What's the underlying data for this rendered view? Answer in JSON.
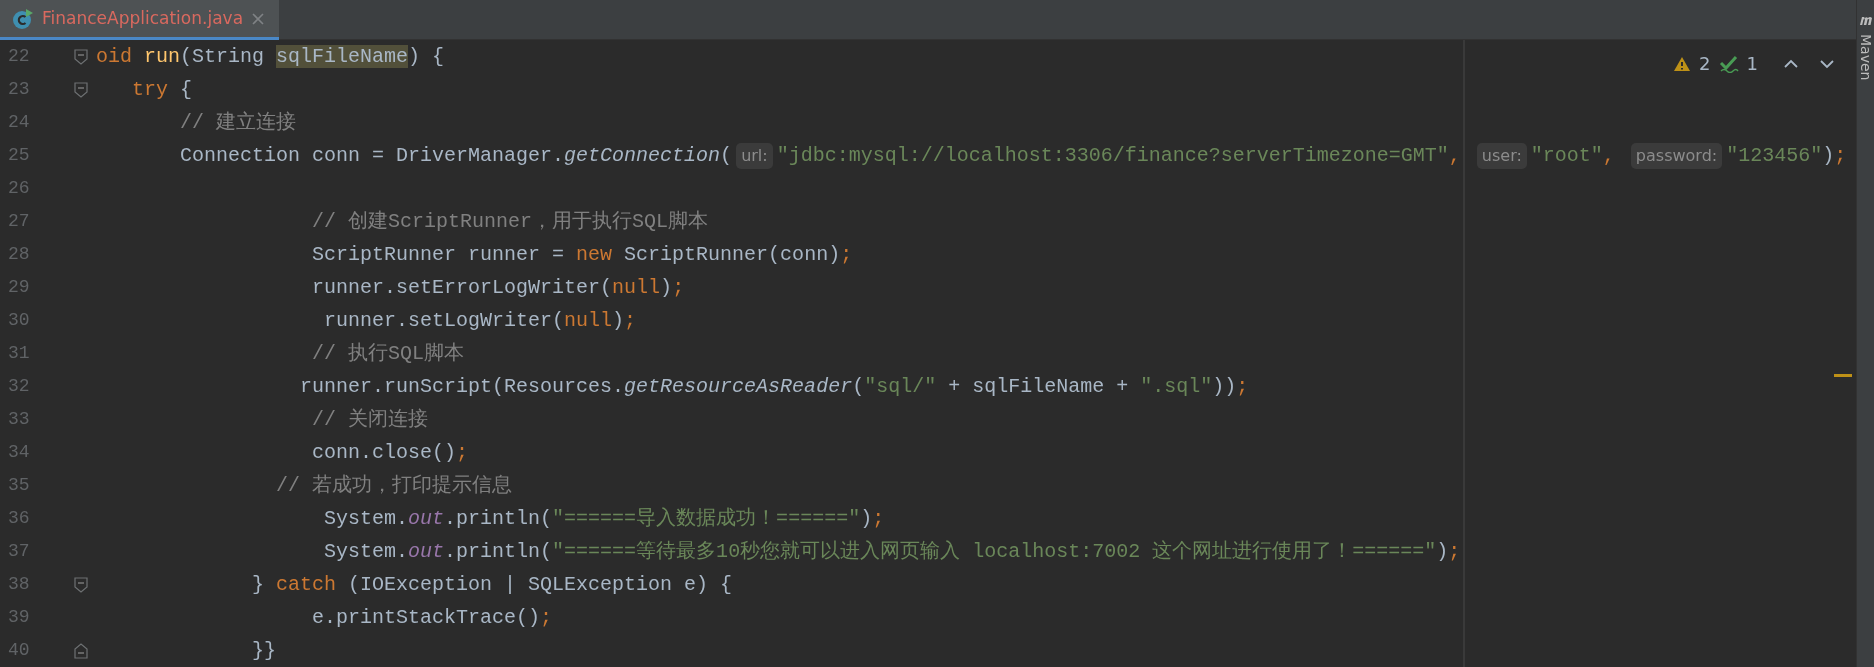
{
  "tabs": [
    {
      "label": "FinanceApplication.java",
      "selected": true
    }
  ],
  "inspections": {
    "warnings": "2",
    "weak_warnings": "1"
  },
  "side_panel": {
    "label": "Maven"
  },
  "lines": [
    {
      "number": "22",
      "fold_start": true,
      "tokens": [
        {
          "text": "oid ",
          "kind": "keyword"
        },
        {
          "text": "run",
          "kind": "function"
        },
        {
          "text": "(String ",
          "kind": "plain"
        },
        {
          "text": "sqlFileName",
          "kind": "match"
        },
        {
          "text": ") {",
          "kind": "plain"
        }
      ]
    },
    {
      "number": "23",
      "fold_start": true,
      "tokens": [
        {
          "text": "   try",
          "kind": "keyword"
        },
        {
          "text": " {",
          "kind": "plain"
        }
      ]
    },
    {
      "number": "24",
      "tokens": [
        {
          "text": "       // 建立连接",
          "kind": "comment"
        }
      ]
    },
    {
      "number": "25",
      "tokens": [
        {
          "text": "       Connection conn = DriverManager.",
          "kind": "plain"
        },
        {
          "text": "getConnection",
          "kind": "static"
        },
        {
          "text": "(",
          "kind": "plain"
        },
        {
          "text": "url:",
          "kind": "hint"
        },
        {
          "text": "\"jdbc:mysql://localhost:3306/finance?serverTimezone=GMT\"",
          "kind": "string"
        },
        {
          "text": ", ",
          "kind": "punct"
        },
        {
          "text": "user:",
          "kind": "hint"
        },
        {
          "text": "\"root\"",
          "kind": "string"
        },
        {
          "text": ", ",
          "kind": "punct"
        },
        {
          "text": "password:",
          "kind": "hint"
        },
        {
          "text": "\"123456\"",
          "kind": "string"
        },
        {
          "text": ")",
          "kind": "plain"
        },
        {
          "text": ";",
          "kind": "punct"
        }
      ]
    },
    {
      "number": "26"
    },
    {
      "number": "27",
      "tokens": [
        {
          "text": "                  // 创建ScriptRunner，用于执行SQL脚本",
          "kind": "comment"
        }
      ]
    },
    {
      "number": "28",
      "tokens": [
        {
          "text": "                  ScriptRunner runner = ",
          "kind": "plain"
        },
        {
          "text": "new",
          "kind": "keyword"
        },
        {
          "text": " ScriptRunner(conn)",
          "kind": "plain"
        },
        {
          "text": ";",
          "kind": "punct"
        }
      ]
    },
    {
      "number": "29",
      "tokens": [
        {
          "text": "                  runner.setErrorLogWriter(",
          "kind": "plain"
        },
        {
          "text": "null",
          "kind": "keyword"
        },
        {
          "text": ")",
          "kind": "plain"
        },
        {
          "text": ";",
          "kind": "punct"
        }
      ]
    },
    {
      "number": "30",
      "tokens": [
        {
          "text": "                   runner.setLogWriter(",
          "kind": "plain"
        },
        {
          "text": "null",
          "kind": "keyword"
        },
        {
          "text": ")",
          "kind": "plain"
        },
        {
          "text": ";",
          "kind": "punct"
        }
      ]
    },
    {
      "number": "31",
      "tokens": [
        {
          "text": "                  // 执行SQL脚本",
          "kind": "comment"
        }
      ]
    },
    {
      "number": "32",
      "tokens": [
        {
          "text": "                 runner.runScript(Resources.",
          "kind": "plain"
        },
        {
          "text": "getResourceAsReader",
          "kind": "static"
        },
        {
          "text": "(",
          "kind": "plain"
        },
        {
          "text": "\"sql/\"",
          "kind": "string"
        },
        {
          "text": " + sqlFileName + ",
          "kind": "plain"
        },
        {
          "text": "\".sql\"",
          "kind": "string"
        },
        {
          "text": "))",
          "kind": "plain"
        },
        {
          "text": ";",
          "kind": "punct"
        }
      ]
    },
    {
      "number": "33",
      "tokens": [
        {
          "text": "                  // 关闭连接",
          "kind": "comment"
        }
      ]
    },
    {
      "number": "34",
      "tokens": [
        {
          "text": "                  conn.close()",
          "kind": "plain"
        },
        {
          "text": ";",
          "kind": "punct"
        }
      ]
    },
    {
      "number": "35",
      "tokens": [
        {
          "text": "               // 若成功，打印提示信息",
          "kind": "comment"
        }
      ]
    },
    {
      "number": "36",
      "tokens": [
        {
          "text": "                   System.",
          "kind": "plain"
        },
        {
          "text": "out",
          "kind": "field"
        },
        {
          "text": ".println(",
          "kind": "plain"
        },
        {
          "text": "\"======导入数据成功！======\"",
          "kind": "string"
        },
        {
          "text": ")",
          "kind": "plain"
        },
        {
          "text": ";",
          "kind": "punct"
        }
      ]
    },
    {
      "number": "37",
      "tokens": [
        {
          "text": "                   System.",
          "kind": "plain"
        },
        {
          "text": "out",
          "kind": "field"
        },
        {
          "text": ".println(",
          "kind": "plain"
        },
        {
          "text": "\"======等待最多10秒您就可以进入网页输入 localhost:7002 这个网址进行使用了！======\"",
          "kind": "string"
        },
        {
          "text": ")",
          "kind": "plain"
        },
        {
          "text": ";",
          "kind": "punct"
        }
      ]
    },
    {
      "number": "38",
      "fold_start": true,
      "tokens": [
        {
          "text": "             } ",
          "kind": "plain"
        },
        {
          "text": "catch",
          "kind": "keyword"
        },
        {
          "text": " (IOException | SQLException e) {",
          "kind": "plain"
        }
      ]
    },
    {
      "number": "39",
      "tokens": [
        {
          "text": "                  e.printStackTrace()",
          "kind": "plain"
        },
        {
          "text": ";",
          "kind": "punct"
        }
      ]
    },
    {
      "number": "40",
      "fold_end": true,
      "tokens": [
        {
          "text": "             }}",
          "kind": "plain"
        }
      ]
    }
  ]
}
